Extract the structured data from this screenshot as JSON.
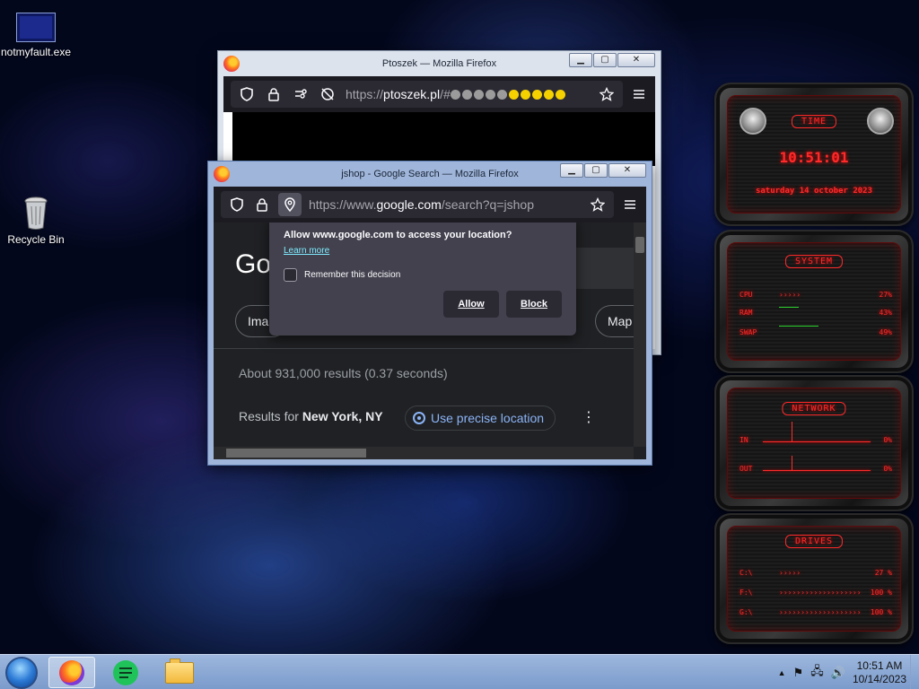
{
  "desktop": {
    "icons": [
      {
        "label": "notmyfault.exe"
      },
      {
        "label": "Recycle Bin"
      }
    ]
  },
  "back_window": {
    "title": "Ptoszek — Mozilla Firefox",
    "url_prefix": "https://",
    "url_host": "ptoszek.pl",
    "url_rest": "/#",
    "url_dots": [
      "gray",
      "gray",
      "gray",
      "gray",
      "gray",
      "yellow",
      "yellow",
      "yellow",
      "yellow",
      "yellow"
    ]
  },
  "front_window": {
    "title": "jshop - Google Search — Mozilla Firefox",
    "url_prefix": "https://www.",
    "url_host": "google.com",
    "url_rest": "/search?q=jshop",
    "google_logo_partial": "Go",
    "chips": [
      "Imag",
      "Map"
    ],
    "results_stats": "About 931,000 results (0.37 seconds)",
    "results_for_prefix": "Results for",
    "results_for_location": "New York, NY",
    "precise_location_label": "Use precise location",
    "permission_popup": {
      "message": "Allow www.google.com to access your location?",
      "learn_more": "Learn more",
      "remember_label": "Remember this decision",
      "allow_label": "Allow",
      "block_label": "Block"
    }
  },
  "gadget": {
    "time": {
      "title": "TIME",
      "clock": "10:51:01",
      "date": "saturday 14 october 2023"
    },
    "system": {
      "title": "SYSTEM",
      "rows": [
        {
          "label": "CPU",
          "bar": "›››››",
          "value": "27%"
        },
        {
          "label": "RAM",
          "bar": "",
          "value": "43%"
        },
        {
          "label": "SWAP",
          "bar": "",
          "value": "49%"
        }
      ]
    },
    "network": {
      "title": "NETWORK",
      "rows": [
        {
          "label": "IN",
          "value": "0%"
        },
        {
          "label": "OUT",
          "value": "0%"
        }
      ]
    },
    "drives": {
      "title": "DRIVES",
      "rows": [
        {
          "label": "C:\\",
          "bar": "›››››",
          "value": "27 %"
        },
        {
          "label": "F:\\",
          "bar": "›››››››››››››››››››",
          "value": "100 %"
        },
        {
          "label": "G:\\",
          "bar": "›››››››››››››››››››",
          "value": "100 %"
        }
      ]
    }
  },
  "taskbar": {
    "clock_time": "10:51 AM",
    "clock_date": "10/14/2023"
  },
  "colors": {
    "accent_red": "#ff2a2a",
    "firefox_dark": "#1c1b22",
    "dot_gray": "#9b9b9b",
    "dot_yellow": "#f5d100"
  }
}
